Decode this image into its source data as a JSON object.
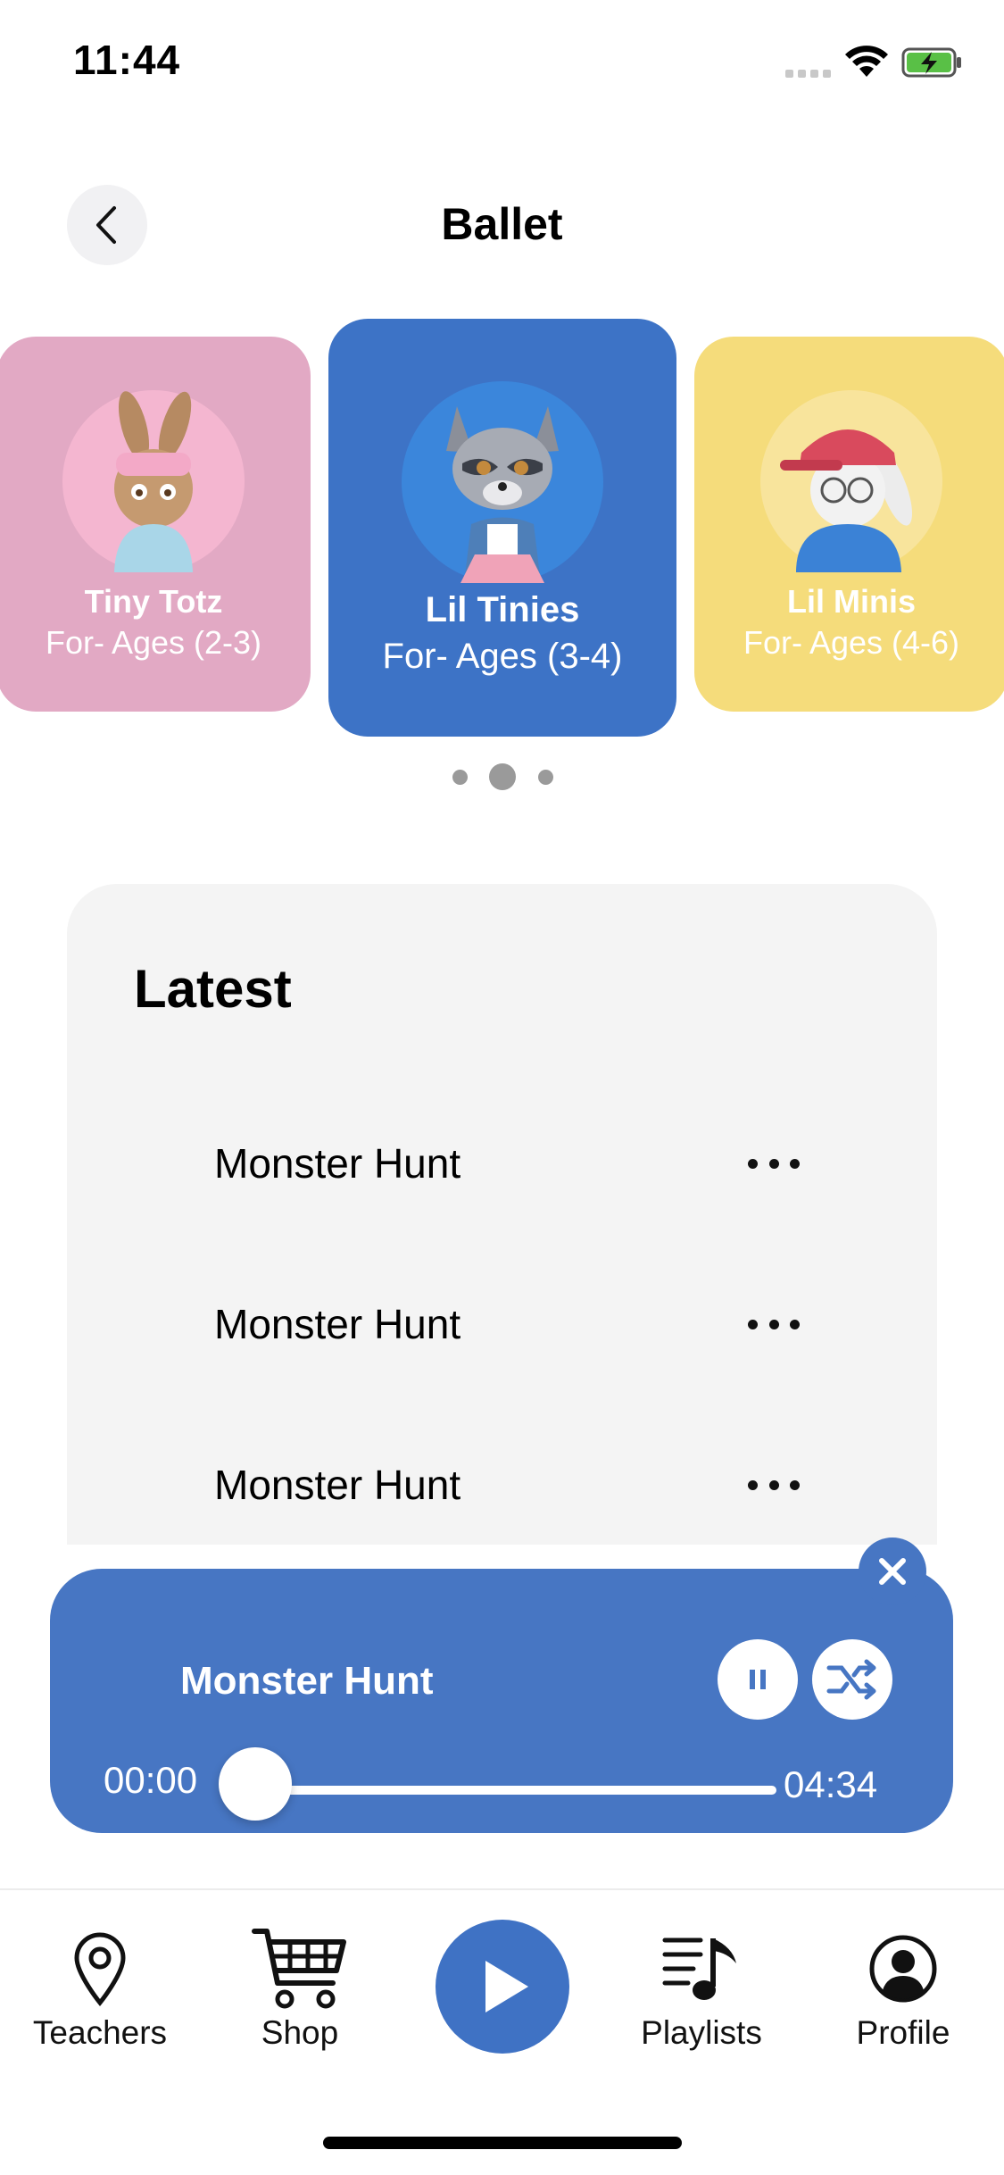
{
  "status_bar": {
    "time": "11:44"
  },
  "header": {
    "title": "Ballet"
  },
  "age_cards": [
    {
      "title": "Tiny Totz",
      "subtitle": "For- Ages (2-3)",
      "color": "#e2a9c4"
    },
    {
      "title": "Lil Tinies",
      "subtitle": "For- Ages (3-4)",
      "color": "#3d73c6"
    },
    {
      "title": "Lil Minis",
      "subtitle": "For- Ages (4-6)",
      "color": "#f5dc7b"
    }
  ],
  "pager": {
    "count": 3,
    "active_index": 1
  },
  "latest": {
    "title": "Latest",
    "tracks": [
      {
        "name": "Monster Hunt"
      },
      {
        "name": "Monster Hunt"
      },
      {
        "name": "Monster Hunt"
      }
    ]
  },
  "player": {
    "title": "Monster Hunt",
    "current_time": "00:00",
    "total_time": "04:34",
    "progress": 0,
    "accent": "#4776c3"
  },
  "tab_bar": {
    "items": [
      {
        "label": "Teachers",
        "icon": "map-pin-icon"
      },
      {
        "label": "Shop",
        "icon": "cart-icon"
      },
      {
        "label": "",
        "icon": "play-icon"
      },
      {
        "label": "Playlists",
        "icon": "playlist-icon"
      },
      {
        "label": "Profile",
        "icon": "profile-icon"
      }
    ]
  }
}
